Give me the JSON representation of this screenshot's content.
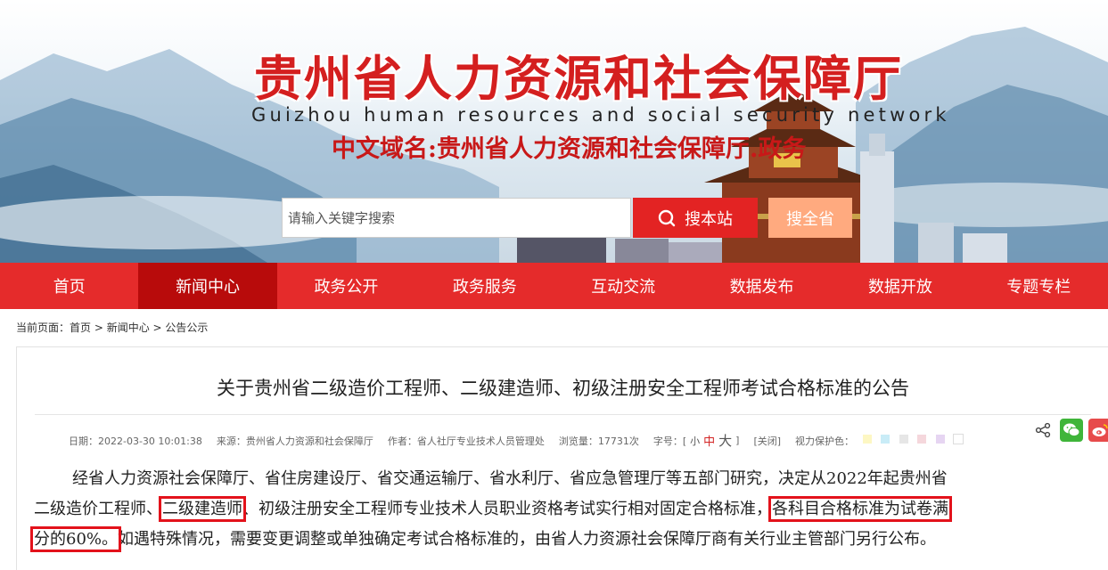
{
  "header": {
    "title": "贵州省人力资源和社会保障厅",
    "subtitle": "Guizhou human resources and social security network",
    "domain_text": "中文域名:贵州省人力资源和社会保障厅.政务",
    "search_placeholder": "请输入关键字搜索",
    "search_site_label": "搜本站",
    "search_province_label": "搜全省",
    "colors": {
      "brand_red": "#e52b2b",
      "active_nav": "#b80b0b",
      "orange": "#ffaa7f"
    }
  },
  "nav": {
    "items": [
      "首页",
      "新闻中心",
      "政务公开",
      "政务服务",
      "互动交流",
      "数据发布",
      "数据开放",
      "专题专栏"
    ],
    "active_index": 1
  },
  "breadcrumb": {
    "prefix": "当前页面：",
    "items": [
      "首页",
      "新闻中心",
      "公告公示"
    ],
    "sep": " > "
  },
  "article": {
    "title": "关于贵州省二级造价工程师、二级建造师、初级注册安全工程师考试合格标准的公告",
    "meta": {
      "date": "日期：2022-03-30 10:01:38",
      "source": "来源：贵州省人力资源和社会保障厅",
      "author": "作者：省人社厅专业技术人员管理处",
      "views": "浏览量：17731次",
      "font_label": "字号：[",
      "font_small": "小",
      "font_mid": "中",
      "font_big": "大",
      "font_end": "]",
      "close_label": "[关闭]",
      "eye_label": "视力保护色：",
      "swatches": [
        "#fdf7c3",
        "#c9ecf7",
        "#e6e6e6",
        "#f5d7dc",
        "#e6d5f2",
        "#ffffff"
      ]
    },
    "share": {
      "icons": [
        "share-icon",
        "wechat-icon",
        "weibo-icon"
      ]
    },
    "paragraph": {
      "line1": "经省人力资源社会保障厅、省住房建设厅、省交通运输厅、省水利厅、省应急管理厅等五部门研究，决定从2022年起贵州省",
      "line2_a": "二级造价工程师、",
      "line2_hl1": "二级建造师",
      "line2_b": "、初级注册安全工程师专业技术人员职业资格考试实行相对固定合格标准，",
      "line2_hl2": "各科目合格标准为试卷满",
      "line3_hl": "分的60%。",
      "line3_b": "如遇特殊情况，需要变更调整或单独确定考试合格标准的，由省人力资源社会保障厅商有关行业主管部门另行公布。"
    }
  }
}
